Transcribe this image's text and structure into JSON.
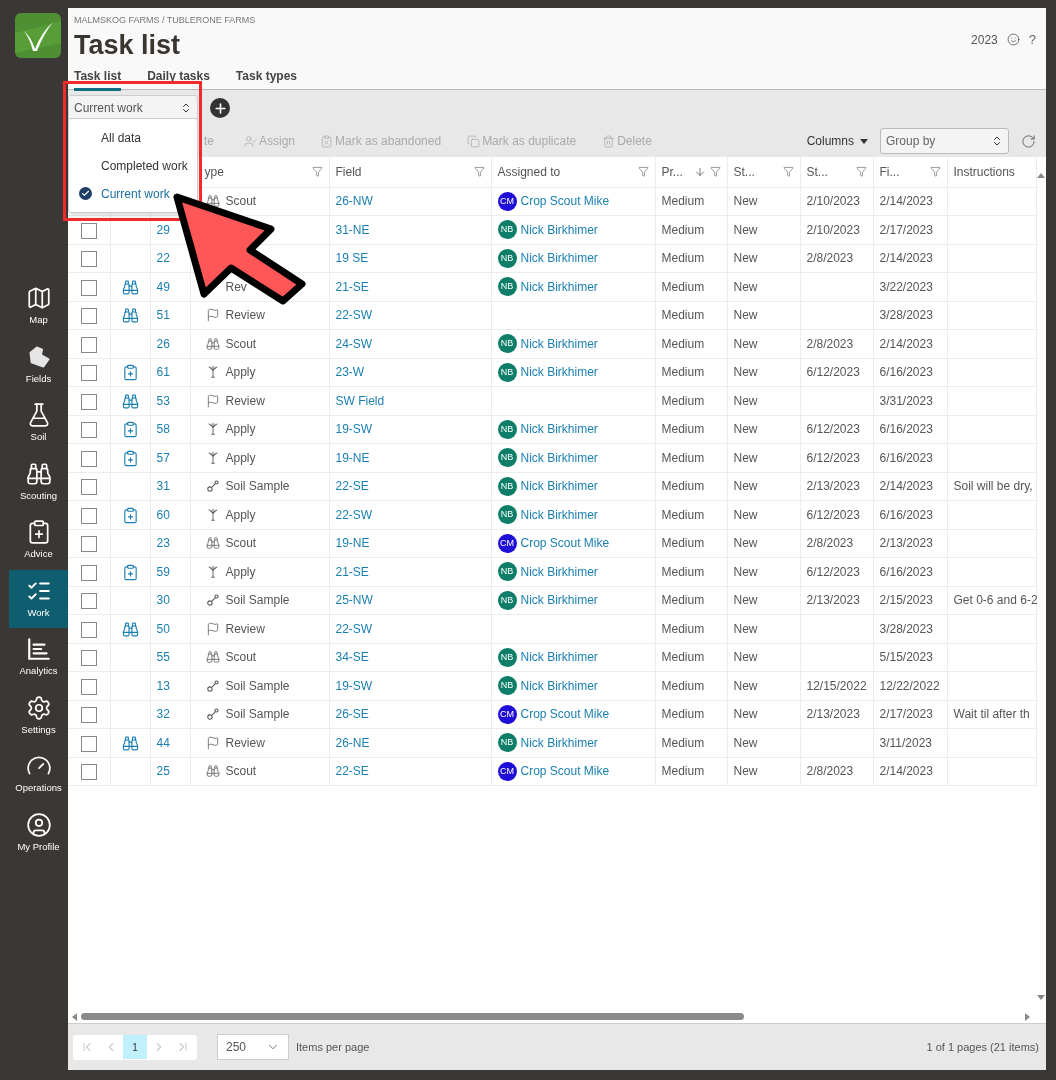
{
  "sidebar": {
    "items": [
      {
        "label": "Map",
        "selected": false
      },
      {
        "label": "Fields",
        "selected": false
      },
      {
        "label": "Soil",
        "selected": false
      },
      {
        "label": "Scouting",
        "selected": false
      },
      {
        "label": "Advice",
        "selected": false
      },
      {
        "label": "Work",
        "selected": true
      },
      {
        "label": "Analytics",
        "selected": false
      },
      {
        "label": "Settings",
        "selected": false
      },
      {
        "label": "Operations",
        "selected": false
      },
      {
        "label": "My Profile",
        "selected": false
      }
    ]
  },
  "header": {
    "breadcrumb": "MALMSKOG FARMS / TUBLERONE FARMS",
    "title": "Task list",
    "year": "2023",
    "help": "?"
  },
  "tabs": [
    {
      "label": "Task list",
      "selected": true
    },
    {
      "label": "Daily tasks",
      "selected": false
    },
    {
      "label": "Task types",
      "selected": false
    }
  ],
  "view_select": {
    "value": "Current work",
    "options": [
      {
        "label": "All data",
        "selected": false
      },
      {
        "label": "Completed work",
        "selected": false
      },
      {
        "label": "Current work",
        "selected": true
      }
    ]
  },
  "actions": [
    {
      "label": "te",
      "disabled": true
    },
    {
      "label": "Assign",
      "disabled": true
    },
    {
      "label": "Mark as abandoned",
      "disabled": true
    },
    {
      "label": "Mark as duplicate",
      "disabled": true
    },
    {
      "label": "Delete",
      "disabled": true
    }
  ],
  "columns_button": "Columns",
  "group_by": {
    "placeholder": "Group by"
  },
  "table": {
    "columns": [
      {
        "label": "ype",
        "filter": true
      },
      {
        "label": "Field",
        "filter": true
      },
      {
        "label": "Assigned to",
        "filter": true
      },
      {
        "label": "Pr...",
        "filter": true,
        "sorted": true
      },
      {
        "label": "St...",
        "filter": true
      },
      {
        "label": "St...",
        "filter": true
      },
      {
        "label": "Fi...",
        "filter": true
      },
      {
        "label": "Instructions"
      }
    ],
    "rows": [
      {
        "type": "Scout",
        "kind": "scout",
        "field": "26-NW",
        "assignee": {
          "initials": "CM",
          "name": "Crop Scout Mike",
          "color": "#1f0ed8"
        },
        "priority": "Medium",
        "status": "New",
        "start": "2/10/2023",
        "finish": "2/14/2023"
      },
      {
        "checked": false,
        "id": "29",
        "field": "31-NE",
        "assignee": {
          "initials": "NB",
          "name": "Nick Birkhimer",
          "color": "#0e7e68"
        },
        "priority": "Medium",
        "status": "New",
        "start": "2/10/2023",
        "finish": "2/17/2023"
      },
      {
        "checked": false,
        "id": "22",
        "field": "19 SE",
        "assignee": {
          "initials": "NB",
          "name": "Nick Birkhimer",
          "color": "#0e7e68"
        },
        "priority": "Medium",
        "status": "New",
        "start": "2/8/2023",
        "finish": "2/14/2023"
      },
      {
        "checked": false,
        "source": {
          "kind": "scouting"
        },
        "id": "49",
        "type": "Rev",
        "field": "21-SE",
        "assignee": {
          "initials": "NB",
          "name": "Nick Birkhimer",
          "color": "#0e7e68"
        },
        "priority": "Medium",
        "status": "New",
        "finish": "3/22/2023"
      },
      {
        "checked": false,
        "source": {
          "kind": "scouting"
        },
        "id": "51",
        "type": "Review",
        "kind": "review",
        "field": "22-SW",
        "priority": "Medium",
        "status": "New",
        "finish": "3/28/2023"
      },
      {
        "checked": false,
        "id": "26",
        "type": "Scout",
        "kind": "scout",
        "field": "24-SW",
        "assignee": {
          "initials": "NB",
          "name": "Nick Birkhimer",
          "color": "#0e7e68"
        },
        "priority": "Medium",
        "status": "New",
        "start": "2/8/2023",
        "finish": "2/14/2023"
      },
      {
        "checked": false,
        "source": {
          "kind": "advice"
        },
        "id": "61",
        "type": "Apply",
        "kind": "apply",
        "field": "23-W",
        "assignee": {
          "initials": "NB",
          "name": "Nick Birkhimer",
          "color": "#0e7e68"
        },
        "priority": "Medium",
        "status": "New",
        "start": "6/12/2023",
        "finish": "6/16/2023"
      },
      {
        "checked": false,
        "source": {
          "kind": "scouting"
        },
        "id": "53",
        "type": "Review",
        "kind": "review",
        "field": "SW Field",
        "priority": "Medium",
        "status": "New",
        "finish": "3/31/2023"
      },
      {
        "checked": false,
        "source": {
          "kind": "advice"
        },
        "id": "58",
        "type": "Apply",
        "kind": "apply",
        "field": "19-SW",
        "assignee": {
          "initials": "NB",
          "name": "Nick Birkhimer",
          "color": "#0e7e68"
        },
        "priority": "Medium",
        "status": "New",
        "start": "6/12/2023",
        "finish": "6/16/2023"
      },
      {
        "checked": false,
        "source": {
          "kind": "advice"
        },
        "id": "57",
        "type": "Apply",
        "kind": "apply",
        "field": "19-NE",
        "assignee": {
          "initials": "NB",
          "name": "Nick Birkhimer",
          "color": "#0e7e68"
        },
        "priority": "Medium",
        "status": "New",
        "start": "6/12/2023",
        "finish": "6/16/2023"
      },
      {
        "checked": false,
        "id": "31",
        "type": "Soil Sample",
        "kind": "soil_sample",
        "field": "22-SE",
        "assignee": {
          "initials": "NB",
          "name": "Nick Birkhimer",
          "color": "#0e7e68"
        },
        "priority": "Medium",
        "status": "New",
        "start": "2/13/2023",
        "finish": "2/14/2023",
        "instructions": "Soil will be dry,"
      },
      {
        "checked": false,
        "source": {
          "kind": "advice"
        },
        "id": "60",
        "type": "Apply",
        "kind": "apply",
        "field": "22-SW",
        "assignee": {
          "initials": "NB",
          "name": "Nick Birkhimer",
          "color": "#0e7e68"
        },
        "priority": "Medium",
        "status": "New",
        "start": "6/12/2023",
        "finish": "6/16/2023"
      },
      {
        "checked": false,
        "id": "23",
        "type": "Scout",
        "kind": "scout",
        "field": "19-NE",
        "assignee": {
          "initials": "CM",
          "name": "Crop Scout Mike",
          "color": "#1f0ed8"
        },
        "priority": "Medium",
        "status": "New",
        "start": "2/8/2023",
        "finish": "2/13/2023"
      },
      {
        "checked": false,
        "source": {
          "kind": "advice"
        },
        "id": "59",
        "type": "Apply",
        "kind": "apply",
        "field": "21-SE",
        "assignee": {
          "initials": "NB",
          "name": "Nick Birkhimer",
          "color": "#0e7e68"
        },
        "priority": "Medium",
        "status": "New",
        "start": "6/12/2023",
        "finish": "6/16/2023"
      },
      {
        "checked": false,
        "id": "30",
        "type": "Soil Sample",
        "kind": "soil_sample",
        "field": "25-NW",
        "assignee": {
          "initials": "NB",
          "name": "Nick Birkhimer",
          "color": "#0e7e68"
        },
        "priority": "Medium",
        "status": "New",
        "start": "2/13/2023",
        "finish": "2/15/2023",
        "instructions": "Get 0-6 and 6-2"
      },
      {
        "checked": false,
        "source": {
          "kind": "scouting"
        },
        "id": "50",
        "type": "Review",
        "kind": "review",
        "field": "22-SW",
        "priority": "Medium",
        "status": "New",
        "finish": "3/28/2023"
      },
      {
        "checked": false,
        "id": "55",
        "type": "Scout",
        "kind": "scout",
        "field": "34-SE",
        "assignee": {
          "initials": "NB",
          "name": "Nick Birkhimer",
          "color": "#0e7e68"
        },
        "priority": "Medium",
        "status": "New",
        "finish": "5/15/2023"
      },
      {
        "checked": false,
        "id": "13",
        "type": "Soil Sample",
        "kind": "soil_sample",
        "field": "19-SW",
        "assignee": {
          "initials": "NB",
          "name": "Nick Birkhimer",
          "color": "#0e7e68"
        },
        "priority": "Medium",
        "status": "New",
        "start": "12/15/2022",
        "finish": "12/22/2022"
      },
      {
        "checked": false,
        "id": "32",
        "type": "Soil Sample",
        "kind": "soil_sample",
        "field": "26-SE",
        "assignee": {
          "initials": "CM",
          "name": "Crop Scout Mike",
          "color": "#1f0ed8"
        },
        "priority": "Medium",
        "status": "New",
        "start": "2/13/2023",
        "finish": "2/17/2023",
        "instructions": "Wait til after th"
      },
      {
        "checked": false,
        "source": {
          "kind": "scouting"
        },
        "id": "44",
        "type": "Review",
        "kind": "review",
        "field": "26-NE",
        "assignee": {
          "initials": "NB",
          "name": "Nick Birkhimer",
          "color": "#0e7e68"
        },
        "priority": "Medium",
        "status": "New",
        "finish": "3/11/2023"
      },
      {
        "checked": false,
        "id": "25",
        "type": "Scout",
        "kind": "scout",
        "field": "22-SE",
        "assignee": {
          "initials": "CM",
          "name": "Crop Scout Mike",
          "color": "#1f0ed8"
        },
        "priority": "Medium",
        "status": "New",
        "start": "2/8/2023",
        "finish": "2/14/2023"
      }
    ]
  },
  "pagination": {
    "pages": [
      {
        "label": "1",
        "selected": true
      }
    ],
    "page_size": "250",
    "page_size_label": "Items per page",
    "summary": "1 of 1 pages (21 items)"
  }
}
